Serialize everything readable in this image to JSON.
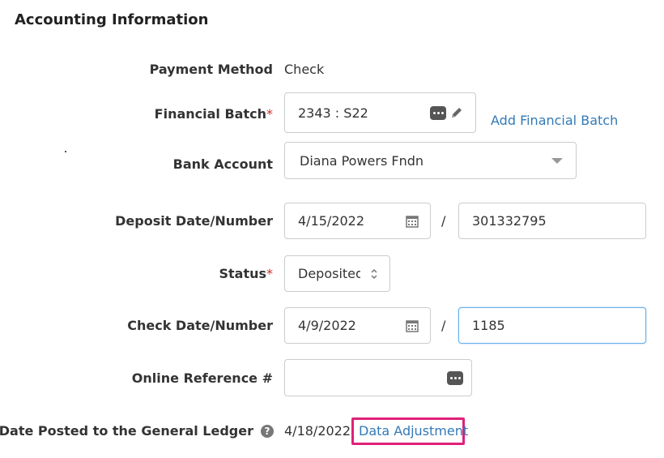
{
  "section": {
    "title": "Accounting Information"
  },
  "payment_method": {
    "label": "Payment Method",
    "value": "Check"
  },
  "financial_batch": {
    "label": "Financial Batch",
    "required": "*",
    "value": "2343 : S22",
    "add_link": "Add Financial Batch"
  },
  "bank_account": {
    "label": "Bank Account",
    "value": "Diana Powers Fndn"
  },
  "deposit": {
    "label": "Deposit Date/Number",
    "date": "4/15/2022",
    "separator": "/",
    "number": "301332795"
  },
  "status": {
    "label": "Status",
    "required": "*",
    "value": "Deposited"
  },
  "check": {
    "label": "Check Date/Number",
    "date": "4/9/2022",
    "separator": "/",
    "number": "1185"
  },
  "online_reference": {
    "label": "Online Reference #",
    "value": ""
  },
  "gl_posted": {
    "label": "Date Posted to the General Ledger",
    "help": "?",
    "value": "4/18/2022",
    "adjust_link": "Data Adjustment"
  },
  "colors": {
    "link": "#337ab7",
    "required": "#c9302c",
    "highlight": "#e0217a",
    "focus": "#66afe9"
  }
}
